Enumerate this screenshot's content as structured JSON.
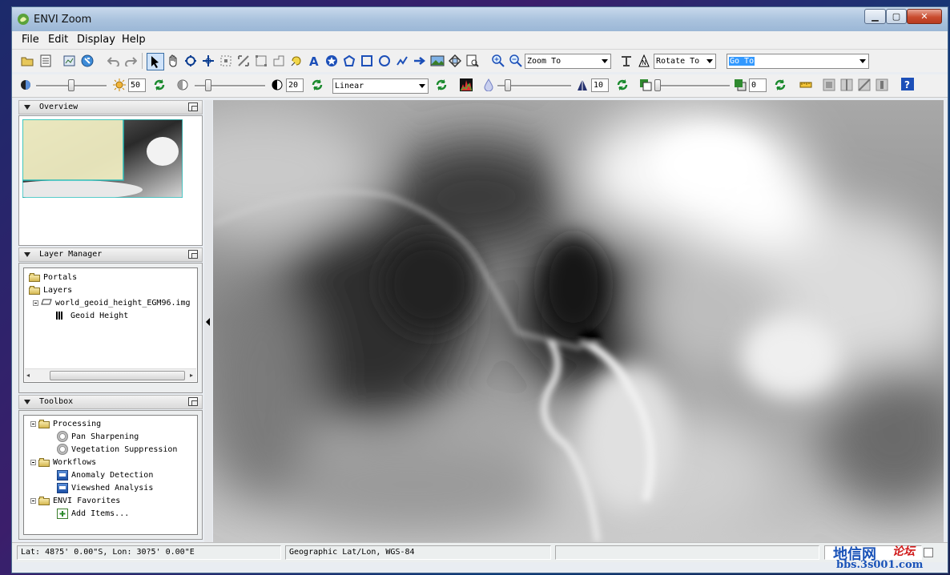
{
  "window": {
    "title": "ENVI Zoom"
  },
  "menu": [
    "File",
    "Edit",
    "Display",
    "Help"
  ],
  "toolbar": {
    "zoom_to": "Zoom To",
    "rotate_to": "Rotate To",
    "go_to": "Go To",
    "brightness": "50",
    "contrast": "20",
    "stretch": "Linear",
    "sharpen": "10",
    "transparency": "0"
  },
  "overview": {
    "title": "Overview"
  },
  "layer_manager": {
    "title": "Layer Manager",
    "items": [
      "Portals",
      "Layers",
      "world_geoid_height_EGM96.img",
      "Geoid Height"
    ]
  },
  "toolbox": {
    "title": "Toolbox",
    "items": [
      "Processing",
      "Pan Sharpening",
      "Vegetation Suppression",
      "Workflows",
      "Anomaly Detection",
      "Viewshed Analysis",
      "ENVI Favorites",
      "Add Items..."
    ]
  },
  "status": {
    "coords": "Lat: 48?5' 0.00\"S, Lon: 30?5' 0.00\"E",
    "projection": "Geographic Lat/Lon, WGS-84",
    "empty": ""
  },
  "watermark": {
    "brand": "地信网",
    "tag": "论坛",
    "url": "bbs.3s001.com"
  },
  "colors": {
    "titlebar": "#a9c2dd",
    "selection": "#3399ff",
    "raster_light": "#f5f5f5",
    "raster_dark": "#1c1c1c"
  }
}
